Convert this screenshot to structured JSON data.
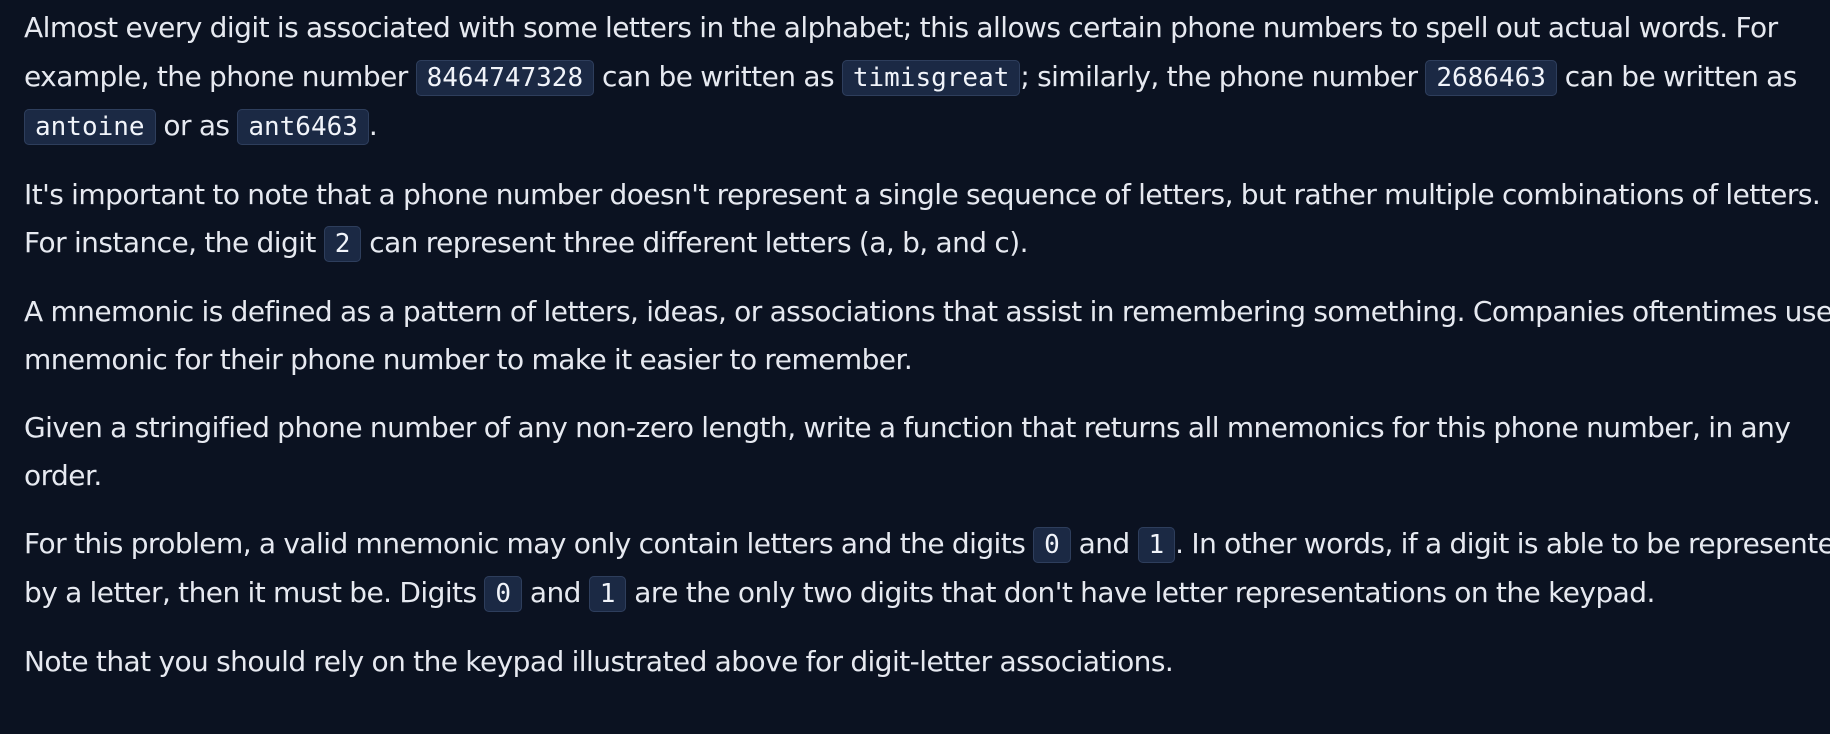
{
  "p1": {
    "t1": "Almost every digit is associated with some letters in the alphabet; this allows certain phone numbers to spell out actual words. For",
    "t2": "example, the phone number ",
    "c1": "8464747328",
    "t3": " can be written as ",
    "c2": "timisgreat",
    "t4": "; similarly, the phone number ",
    "c3": "2686463",
    "t5": " can be written as",
    "c4": "antoine",
    "t6": " or as ",
    "c5": "ant6463",
    "t7": "."
  },
  "p2": {
    "t1": "It's important to note that a phone number doesn't represent a single sequence of letters, but rather multiple combinations of letters.",
    "t2": "For instance, the digit ",
    "c1": "2",
    "t3": " can represent three different letters (a, b, and c)."
  },
  "p3": {
    "t1": "A mnemonic is defined as a pattern of letters, ideas, or associations that assist in remembering something. Companies oftentimes use a",
    "t2": "mnemonic for their phone number to make it easier to remember."
  },
  "p4": {
    "t1": "Given a stringified phone number of any non-zero length, write a function that returns all mnemonics for this phone number, in any",
    "t2": "order."
  },
  "p5": {
    "t1": "For this problem, a valid mnemonic may only contain letters and the digits ",
    "c1": "0",
    "t2": " and ",
    "c2": "1",
    "t3": ". In other words, if a digit is able to be represented",
    "t4": "by a letter, then it must be. Digits ",
    "c3": "0",
    "t5": " and ",
    "c4": "1",
    "t6": " are the only two digits that don't have letter representations on the keypad."
  },
  "p6": {
    "t1": "Note that you should rely on the keypad illustrated above for digit-letter associations."
  }
}
